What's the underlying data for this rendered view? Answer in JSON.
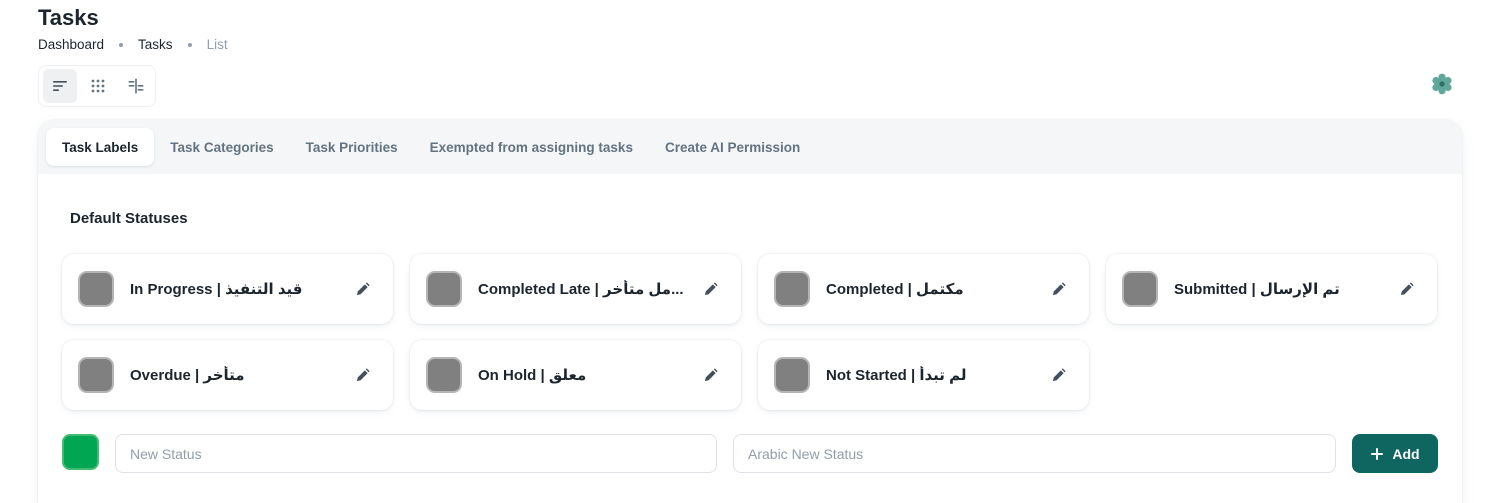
{
  "page": {
    "title": "Tasks",
    "breadcrumb": [
      "Dashboard",
      "Tasks",
      "List"
    ]
  },
  "view_toggle": {
    "icons": [
      "list-view-icon",
      "grid-view-icon",
      "kanban-view-icon"
    ],
    "active": "list-view-icon"
  },
  "settings": {
    "icon": "gear-icon",
    "color": "#5fa89a"
  },
  "tabs": [
    {
      "label": "Task Labels",
      "active": true
    },
    {
      "label": "Task Categories",
      "active": false
    },
    {
      "label": "Task Priorities",
      "active": false
    },
    {
      "label": "Exempted from assigning tasks",
      "active": false
    },
    {
      "label": "Create AI Permission",
      "active": false
    }
  ],
  "default_statuses": {
    "title": "Default Statuses",
    "items": [
      {
        "label": "In Progress | قيد التنفيذ",
        "color": "#808080"
      },
      {
        "label": "Completed Late | مل متأخر...",
        "color": "#808080"
      },
      {
        "label": "Completed | مكتمل",
        "color": "#808080"
      },
      {
        "label": "Submitted | تم الإرسال",
        "color": "#808080"
      },
      {
        "label": "Overdue | متأخر",
        "color": "#808080"
      },
      {
        "label": "On Hold | معلق",
        "color": "#808080"
      },
      {
        "label": "Not Started | لم تبدأ",
        "color": "#808080"
      }
    ]
  },
  "new_status": {
    "color": "#00a651",
    "name_value": "",
    "name_placeholder": "New Status",
    "arabic_value": "",
    "arabic_placeholder": "Arabic New Status",
    "add_label": "Add",
    "add_color": "#0f6660"
  }
}
